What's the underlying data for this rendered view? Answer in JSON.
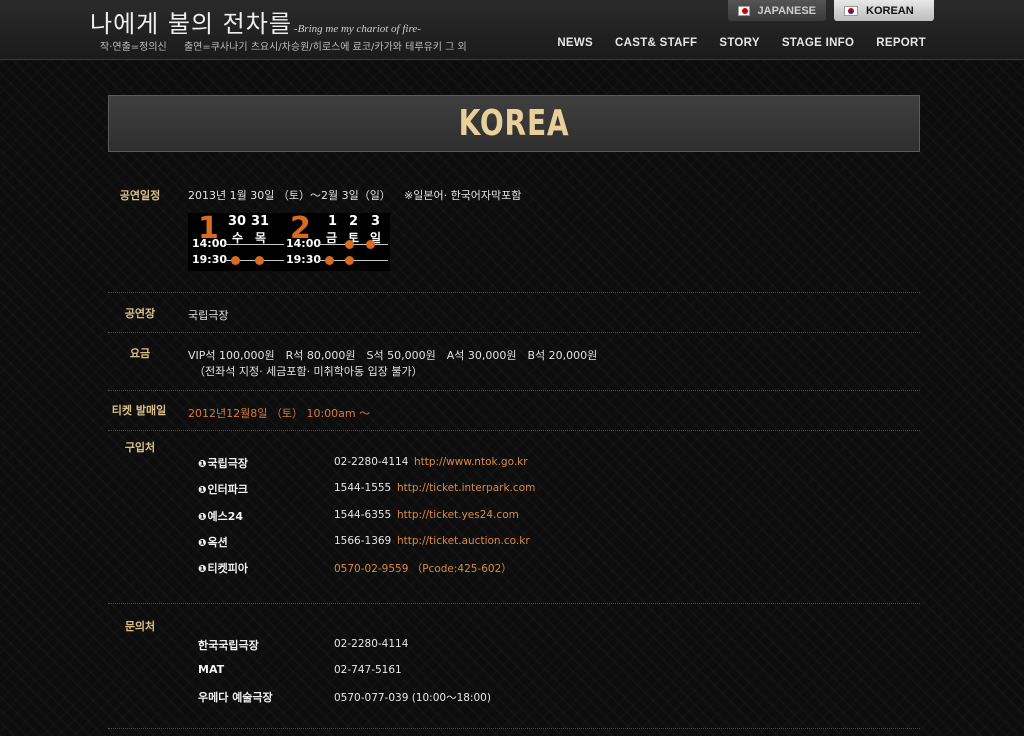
{
  "header": {
    "title": "나에게 불의 전차를",
    "subtitle": "-Bring me my chariot of fire-",
    "credits": [
      "작·연출=정의신",
      "출연=쿠사나기 츠요시/차승원/히로스에 료코/카가와 테루유키 그 외"
    ],
    "lang": {
      "japanese": "JAPANESE",
      "korean": "KOREAN"
    },
    "nav": [
      "NEWS",
      "CAST& STAFF",
      "STORY",
      "STAGE INFO",
      "REPORT"
    ]
  },
  "banner": {
    "title": "KOREA"
  },
  "schedule": {
    "label": "공연일정",
    "period": "2013년 1월 30일 （토）～2월 3일（일）",
    "note": "※일본어· 한국어자막포함",
    "calendar": {
      "month1": "1",
      "month2": "2",
      "dates": [
        "30",
        "31",
        "1",
        "2",
        "3"
      ],
      "days": [
        "수",
        "목",
        "금",
        "토",
        "일"
      ],
      "times": [
        "14:00",
        "19:30"
      ]
    }
  },
  "venue": {
    "label": "공연장",
    "value": "국립극장"
  },
  "price": {
    "label": "요금",
    "line1": "VIP석 100,000원　R석 80,000원　S석 50,000원　A석 30,000원　B석 20,000원",
    "line2": "（전좌석 지정· 세금포함· 미취학아동 입장 불가）"
  },
  "ticket": {
    "label": "티켓 발매일",
    "value": "2012년12월8일 （토） 10:00am ～"
  },
  "purchase": {
    "label": "구입처",
    "vendors": [
      {
        "name": "국립극장",
        "phone": "02-2280-4114",
        "url": "http://www.ntok.go.kr"
      },
      {
        "name": "인터파크",
        "phone": "1544-1555",
        "url": "http://ticket.interpark.com"
      },
      {
        "name": "예스24",
        "phone": "1544-6355",
        "url": "http://ticket.yes24.com"
      },
      {
        "name": "옥션",
        "phone": "1566-1369",
        "url": "http://ticket.auction.co.kr"
      },
      {
        "name": "티켓피아",
        "phone": "",
        "url": "0570-02-9559 （Pcode:425-602）"
      }
    ]
  },
  "contact": {
    "label": "문의처",
    "items": [
      {
        "name": "한국국립극장",
        "phone": "02-2280-4114"
      },
      {
        "name": "MAT",
        "phone": "02-747-5161"
      },
      {
        "name": "우메다 예술극장",
        "phone": "0570-077-039 (10:00～18:00)"
      }
    ]
  }
}
